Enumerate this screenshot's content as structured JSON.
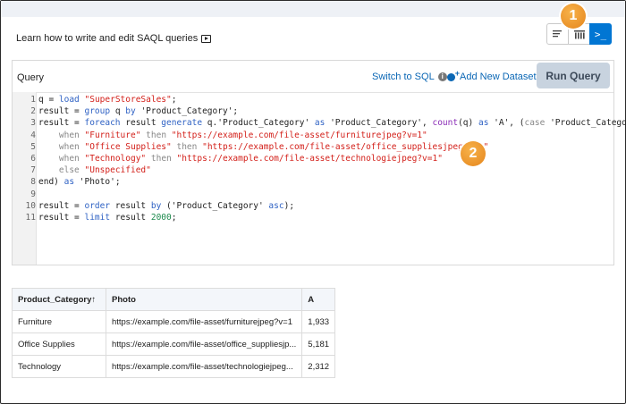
{
  "learn": {
    "text": "Learn how to write and edit SAQL queries"
  },
  "view_toggle": {
    "active_label": ">_"
  },
  "callouts": [
    "1",
    "2"
  ],
  "query_panel": {
    "label": "Query",
    "switch_sql": "Switch to SQL",
    "info_icon": "i",
    "add_dataset": "Add New Dataset",
    "run_button": "Run Query"
  },
  "code": {
    "line_numbers": [
      "1",
      "2",
      "3",
      "4",
      "5",
      "6",
      "7",
      "8",
      "9",
      "10",
      "11"
    ],
    "lines": [
      [
        {
          "t": "q = ",
          "c": ""
        },
        {
          "t": "load",
          "c": "kw"
        },
        {
          "t": " ",
          "c": ""
        },
        {
          "t": "\"SuperStoreSales\"",
          "c": "str"
        },
        {
          "t": ";",
          "c": ""
        }
      ],
      [
        {
          "t": "result = ",
          "c": ""
        },
        {
          "t": "group",
          "c": "kw"
        },
        {
          "t": " q ",
          "c": ""
        },
        {
          "t": "by",
          "c": "kw"
        },
        {
          "t": " 'Product_Category';",
          "c": ""
        }
      ],
      [
        {
          "t": "result = ",
          "c": ""
        },
        {
          "t": "foreach",
          "c": "kw"
        },
        {
          "t": " result ",
          "c": ""
        },
        {
          "t": "generate",
          "c": "kw"
        },
        {
          "t": " q.'Product_Category' ",
          "c": ""
        },
        {
          "t": "as",
          "c": "kw"
        },
        {
          "t": " 'Product_Category', ",
          "c": ""
        },
        {
          "t": "count",
          "c": "fn"
        },
        {
          "t": "(q) ",
          "c": ""
        },
        {
          "t": "as",
          "c": "kw"
        },
        {
          "t": " 'A', (",
          "c": ""
        },
        {
          "t": "case",
          "c": "gray"
        },
        {
          "t": " 'Product_Category'",
          "c": ""
        }
      ],
      [
        {
          "t": "    ",
          "c": ""
        },
        {
          "t": "when",
          "c": "gray"
        },
        {
          "t": " ",
          "c": ""
        },
        {
          "t": "\"Furniture\"",
          "c": "str"
        },
        {
          "t": " ",
          "c": ""
        },
        {
          "t": "then",
          "c": "gray"
        },
        {
          "t": " ",
          "c": ""
        },
        {
          "t": "\"https://example.com/file-asset/furniturejpeg?v=1\"",
          "c": "str"
        }
      ],
      [
        {
          "t": "    ",
          "c": ""
        },
        {
          "t": "when",
          "c": "gray"
        },
        {
          "t": " ",
          "c": ""
        },
        {
          "t": "\"Office Supplies\"",
          "c": "str"
        },
        {
          "t": " ",
          "c": ""
        },
        {
          "t": "then",
          "c": "gray"
        },
        {
          "t": " ",
          "c": ""
        },
        {
          "t": "\"https://example.com/file-asset/office_suppliesjpeg?v=1\"",
          "c": "str"
        }
      ],
      [
        {
          "t": "    ",
          "c": ""
        },
        {
          "t": "when",
          "c": "gray"
        },
        {
          "t": " ",
          "c": ""
        },
        {
          "t": "\"Technology\"",
          "c": "str"
        },
        {
          "t": " ",
          "c": ""
        },
        {
          "t": "then",
          "c": "gray"
        },
        {
          "t": " ",
          "c": ""
        },
        {
          "t": "\"https://example.com/file-asset/technologiejpeg?v=1\"",
          "c": "str"
        }
      ],
      [
        {
          "t": "    ",
          "c": ""
        },
        {
          "t": "else",
          "c": "gray"
        },
        {
          "t": " ",
          "c": ""
        },
        {
          "t": "\"Unspecified\"",
          "c": "str"
        }
      ],
      [
        {
          "t": "end) ",
          "c": ""
        },
        {
          "t": "as",
          "c": "kw"
        },
        {
          "t": " 'Photo';",
          "c": ""
        }
      ],
      [
        {
          "t": "",
          "c": ""
        }
      ],
      [
        {
          "t": "result = ",
          "c": ""
        },
        {
          "t": "order",
          "c": "kw"
        },
        {
          "t": " result ",
          "c": ""
        },
        {
          "t": "by",
          "c": "kw"
        },
        {
          "t": " ('Product_Category' ",
          "c": ""
        },
        {
          "t": "asc",
          "c": "kw"
        },
        {
          "t": ");",
          "c": ""
        }
      ],
      [
        {
          "t": "result = ",
          "c": ""
        },
        {
          "t": "limit",
          "c": "kw"
        },
        {
          "t": " result ",
          "c": ""
        },
        {
          "t": "2000",
          "c": "num"
        },
        {
          "t": ";",
          "c": ""
        }
      ]
    ]
  },
  "results": {
    "headers": [
      "Product_Category",
      "Photo",
      "A"
    ],
    "sort_indicator": "↑",
    "rows": [
      [
        "Furniture",
        "https://example.com/file-asset/furniturejpeg?v=1",
        "1,933"
      ],
      [
        "Office Supplies",
        "https://example.com/file-asset/office_suppliesjp...",
        "5,181"
      ],
      [
        "Technology",
        "https://example.com/file-asset/technologiejpeg...",
        "2,312"
      ]
    ]
  }
}
